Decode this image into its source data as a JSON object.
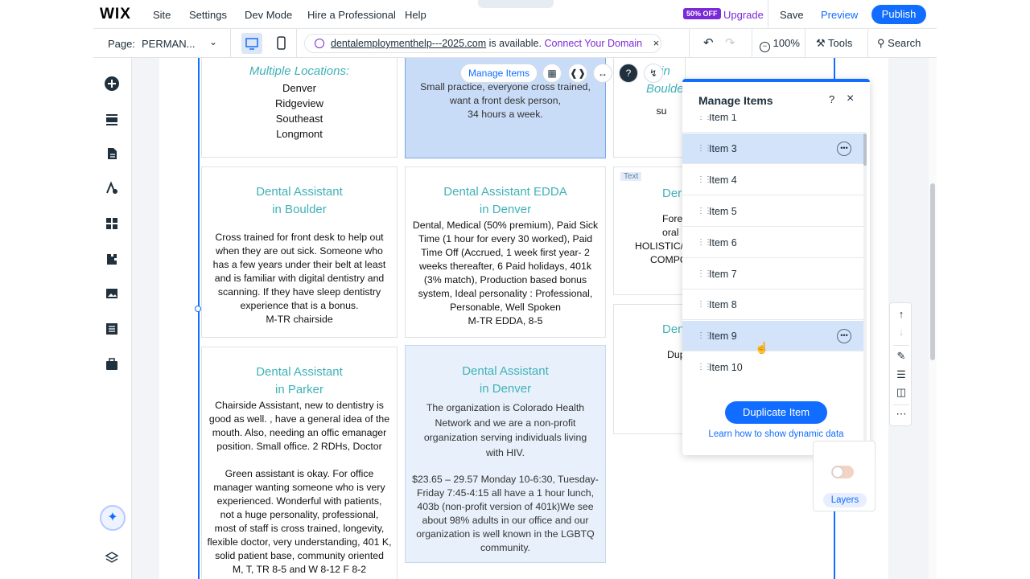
{
  "topbar": {
    "logo": "WIX",
    "menu": [
      "Site",
      "Settings",
      "Dev Mode",
      "Hire a Professional",
      "Help"
    ],
    "collapse_icon": "chevron-up-icon",
    "badge": "50% OFF",
    "upgrade": "Upgrade",
    "save": "Save",
    "preview": "Preview",
    "publish": "Publish"
  },
  "bar2": {
    "page_label": "Page:",
    "page_name": "PERMAN...",
    "url_domain": "dentalemploymenthelp---2025.com",
    "url_available": "is available.",
    "url_connect": "Connect Your Domain",
    "zoom": "100%",
    "tools": "Tools",
    "search": "Search"
  },
  "floating_toolbar": {
    "manage_items": "Manage Items"
  },
  "cards": {
    "top_left": {
      "heading": "Multiple Locations:",
      "lines": [
        "Denver",
        "Ridgeview",
        "Southeast",
        "Longmont"
      ]
    },
    "top_middle": {
      "lines": [
        "Small practice, everyone cross trained,",
        "want a front desk person,",
        "34 hours a week."
      ]
    },
    "top_right": {
      "heading": "in Boulder",
      "line": "su"
    },
    "mid_left": {
      "title1": "Dental Assistant",
      "title2": "in Boulder",
      "body": [
        "Cross trained for front desk to help out",
        "when they are out sick. Someone who",
        "has a few years under their belt at least",
        "and is familiar with digital dentistry and",
        "scanning. If they have sleep dentistry",
        "experience that is a bonus.",
        "M-TR chairside"
      ]
    },
    "mid_middle": {
      "title1": "Dental Assistant EDDA",
      "title2": "in Denver",
      "body": [
        "Dental, Medical (50% premium), Paid Sick",
        "Time (1 hour for every 30 worked), Paid",
        "Time Off (Accrued, 1 week first year- 2",
        "weeks thereafter, 6 Paid holidays, 401k",
        "(3% match), Production based bonus",
        "system, Ideal personality : Professional,",
        "Personable, Well Spoken",
        "M-TR EDDA, 8-5"
      ]
    },
    "mid_right": {
      "text_tag": "Text",
      "title": "Der",
      "body": [
        "Fore",
        "oral",
        "HOLISTIC/S",
        "COMPO"
      ]
    },
    "low_left": {
      "title1": "Dental Assistant",
      "title2": "in Parker",
      "body1": [
        "Chairside Assistant, new to dentistry is",
        "good as well. , have a general idea of the",
        "mouth. Also, needing an offic emanager",
        "position. Small office. 2 RDHs, Doctor"
      ],
      "body2": [
        "Green assistant is okay. For office",
        "manager wanting someone who is very",
        "experienced. Wonderful with patients,",
        "not a huge personality, professional,",
        "most of staff is cross trained, longevity,",
        "flexible doctor, very understanding, 401 K,",
        "solid patient base, community oriented",
        "M, T, TR 8-5 and W 8-12 F 8-2"
      ]
    },
    "low_middle": {
      "title1": "Dental Assistant",
      "title2": "in Denver",
      "body1": [
        "The organization is Colorado Health",
        "Network and we are a non-profit",
        "organization serving individuals living",
        "with HIV."
      ],
      "body2": [
        "$23.65 – 29.57 Monday 10-6:30, Tuesday-",
        "Friday 7:45-4:15 all have a 1 hour lunch,",
        "403b (non-profit version of 401k)We see",
        "about 98% adults in our office and our",
        "organization is well known in the LGBTQ",
        "community."
      ]
    },
    "low_right": {
      "title": "Den",
      "line": "Dup"
    }
  },
  "manage_panel": {
    "title": "Manage Items",
    "help": "?",
    "items": [
      "Item 1",
      "Item 3",
      "Item 4",
      "Item 5",
      "Item 6",
      "Item 7",
      "Item 8",
      "Item 9",
      "Item 10"
    ],
    "duplicate": "Duplicate Item",
    "dynamic_link": "Learn how to show dynamic data"
  },
  "layers_widget": {
    "label": "Layers"
  }
}
